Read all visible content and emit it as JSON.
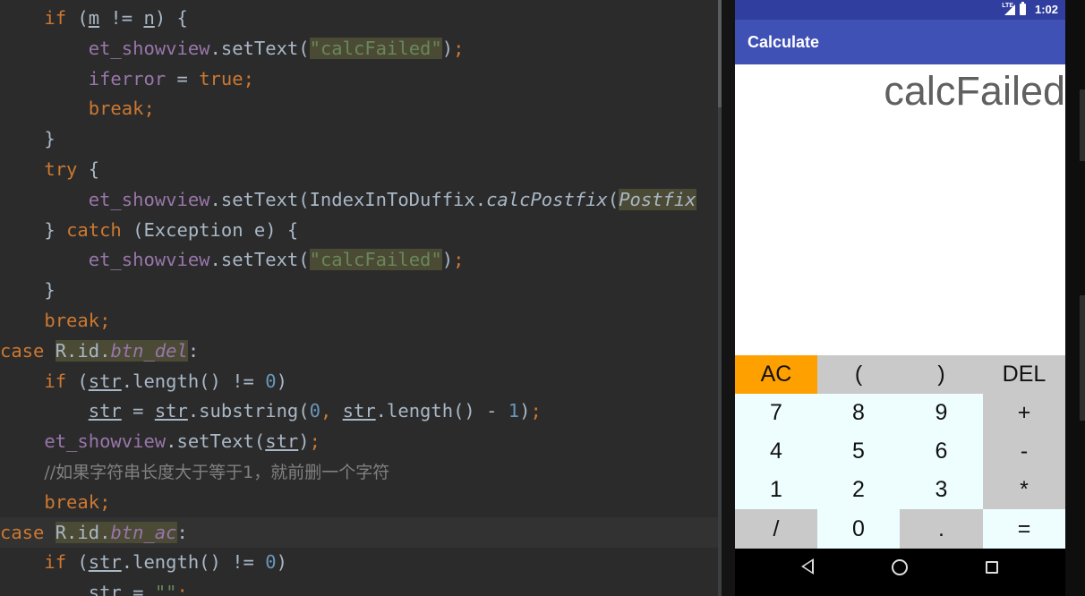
{
  "editor": {
    "lines": [
      [
        {
          "t": "    "
        },
        {
          "t": "if",
          "c": "kw"
        },
        {
          "t": " ("
        },
        {
          "t": "m",
          "c": "u"
        },
        {
          "t": " != "
        },
        {
          "t": "n",
          "c": "u"
        },
        {
          "t": ") {"
        }
      ],
      [
        {
          "t": "        "
        },
        {
          "t": "et_showview",
          "c": "fld"
        },
        {
          "t": ".setText("
        },
        {
          "t": "\"calcFailed\"",
          "c": "str hl"
        },
        {
          "t": ")"
        },
        {
          "t": ";",
          "c": "kw"
        }
      ],
      [
        {
          "t": "        "
        },
        {
          "t": "iferror",
          "c": "fld"
        },
        {
          "t": " = "
        },
        {
          "t": "true",
          "c": "kw"
        },
        {
          "t": ";",
          "c": "kw"
        }
      ],
      [
        {
          "t": "        "
        },
        {
          "t": "break",
          "c": "kw"
        },
        {
          "t": ";",
          "c": "kw"
        }
      ],
      [
        {
          "t": "    }"
        }
      ],
      [
        {
          "t": "    "
        },
        {
          "t": "try",
          "c": "kw"
        },
        {
          "t": " {"
        }
      ],
      [
        {
          "t": "        "
        },
        {
          "t": "et_showview",
          "c": "fld"
        },
        {
          "t": ".setText(IndexInToDuffix."
        },
        {
          "t": "calcPostfix",
          "c": "it"
        },
        {
          "t": "("
        },
        {
          "t": "Postfix",
          "c": "it hl"
        }
      ],
      [
        {
          "t": "    } "
        },
        {
          "t": "catch",
          "c": "kw"
        },
        {
          "t": " (Exception e) {"
        }
      ],
      [
        {
          "t": "        "
        },
        {
          "t": "et_showview",
          "c": "fld"
        },
        {
          "t": ".setText("
        },
        {
          "t": "\"calcFailed\"",
          "c": "str hl"
        },
        {
          "t": ")"
        },
        {
          "t": ";",
          "c": "kw"
        }
      ],
      [
        {
          "t": "    }"
        }
      ],
      [
        {
          "t": "    "
        },
        {
          "t": "break",
          "c": "kw"
        },
        {
          "t": ";",
          "c": "kw"
        }
      ],
      [
        {
          "t": "case",
          "c": "kw"
        },
        {
          "t": " "
        },
        {
          "t": "R.id.",
          "c": "hl"
        },
        {
          "t": "btn_del",
          "c": "fld it hl"
        },
        {
          "t": ":"
        }
      ],
      [
        {
          "t": "    "
        },
        {
          "t": "if",
          "c": "kw"
        },
        {
          "t": " ("
        },
        {
          "t": "str",
          "c": "u"
        },
        {
          "t": ".length() != "
        },
        {
          "t": "0",
          "c": "num"
        },
        {
          "t": ")"
        }
      ],
      [
        {
          "t": "        "
        },
        {
          "t": "str",
          "c": "u"
        },
        {
          "t": " = "
        },
        {
          "t": "str",
          "c": "u"
        },
        {
          "t": ".substring("
        },
        {
          "t": "0",
          "c": "num"
        },
        {
          "t": ", ",
          "c": "kw"
        },
        {
          "t": "str",
          "c": "u"
        },
        {
          "t": ".length() - "
        },
        {
          "t": "1",
          "c": "num"
        },
        {
          "t": ")"
        },
        {
          "t": ";",
          "c": "kw"
        }
      ],
      [
        {
          "t": "    "
        },
        {
          "t": "et_showview",
          "c": "fld"
        },
        {
          "t": ".setText("
        },
        {
          "t": "str",
          "c": "u"
        },
        {
          "t": ")"
        },
        {
          "t": ";",
          "c": "kw"
        }
      ],
      [
        {
          "t": "    "
        },
        {
          "t": "//如果字符串长度大于等于1，就前删一个字符",
          "c": "cmt"
        }
      ],
      [
        {
          "t": "    "
        },
        {
          "t": "break",
          "c": "kw"
        },
        {
          "t": ";",
          "c": "kw"
        }
      ],
      [
        {
          "t": "case",
          "c": "kw"
        },
        {
          "t": " "
        },
        {
          "t": "R.id.",
          "c": "hl"
        },
        {
          "t": "btn_ac",
          "c": "fld it hl"
        },
        {
          "t": ":"
        }
      ],
      [
        {
          "t": "    "
        },
        {
          "t": "if",
          "c": "kw"
        },
        {
          "t": " ("
        },
        {
          "t": "str",
          "c": "u"
        },
        {
          "t": ".length() != "
        },
        {
          "t": "0",
          "c": "num"
        },
        {
          "t": ")"
        }
      ],
      [
        {
          "t": "        "
        },
        {
          "t": "str",
          "c": "u"
        },
        {
          "t": " = "
        },
        {
          "t": "\"\"",
          "c": "str"
        },
        {
          "t": ";",
          "c": "kw"
        }
      ]
    ],
    "current_line": 17
  },
  "phone": {
    "status_time": "1:02",
    "network_label": "LTE",
    "app_title": "Calculate",
    "display_text": "calcFailed",
    "keys": [
      {
        "label": "AC",
        "style": "orange",
        "name": "key-ac"
      },
      {
        "label": "(",
        "style": "gray",
        "name": "key-open-paren"
      },
      {
        "label": ")",
        "style": "gray",
        "name": "key-close-paren"
      },
      {
        "label": "DEL",
        "style": "gray",
        "name": "key-del"
      },
      {
        "label": "7",
        "style": "light",
        "name": "key-7"
      },
      {
        "label": "8",
        "style": "light",
        "name": "key-8"
      },
      {
        "label": "9",
        "style": "light",
        "name": "key-9"
      },
      {
        "label": "+",
        "style": "gray",
        "name": "key-plus"
      },
      {
        "label": "4",
        "style": "light",
        "name": "key-4"
      },
      {
        "label": "5",
        "style": "light",
        "name": "key-5"
      },
      {
        "label": "6",
        "style": "light",
        "name": "key-6"
      },
      {
        "label": "-",
        "style": "gray",
        "name": "key-minus"
      },
      {
        "label": "1",
        "style": "light",
        "name": "key-1"
      },
      {
        "label": "2",
        "style": "light",
        "name": "key-2"
      },
      {
        "label": "3",
        "style": "light",
        "name": "key-3"
      },
      {
        "label": "*",
        "style": "gray",
        "name": "key-multiply"
      },
      {
        "label": "/",
        "style": "gray",
        "name": "key-divide"
      },
      {
        "label": "0",
        "style": "light",
        "name": "key-0"
      },
      {
        "label": ".",
        "style": "gray",
        "name": "key-dot"
      },
      {
        "label": "=",
        "style": "light",
        "name": "key-equals"
      }
    ],
    "nav_icons": [
      "back-icon",
      "home-icon",
      "recents-icon"
    ],
    "colors": {
      "status_bar": "#303f9f",
      "action_bar": "#3f51b5",
      "key_orange": "#fea000",
      "key_gray": "#c9c9c9",
      "key_light": "#eefefe"
    }
  }
}
